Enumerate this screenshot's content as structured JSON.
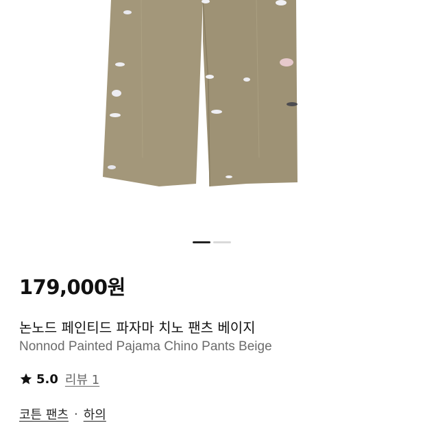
{
  "gallery": {
    "image_alt": "product-photo",
    "slide_count": 2,
    "active_index": 0
  },
  "product": {
    "price": "179,000원",
    "name_ko": "논노드 페인티드 파자마 치노 팬츠 베이지",
    "name_en": "Nonnod Painted Pajama Chino Pants Beige",
    "rating": "5.0",
    "reviews_label": "리뷰 1",
    "categories": [
      "코튼 팬츠",
      "하의"
    ],
    "category_separator": "·"
  },
  "colors": {
    "pants": "#a3977a",
    "accent_dark": "#222222"
  }
}
